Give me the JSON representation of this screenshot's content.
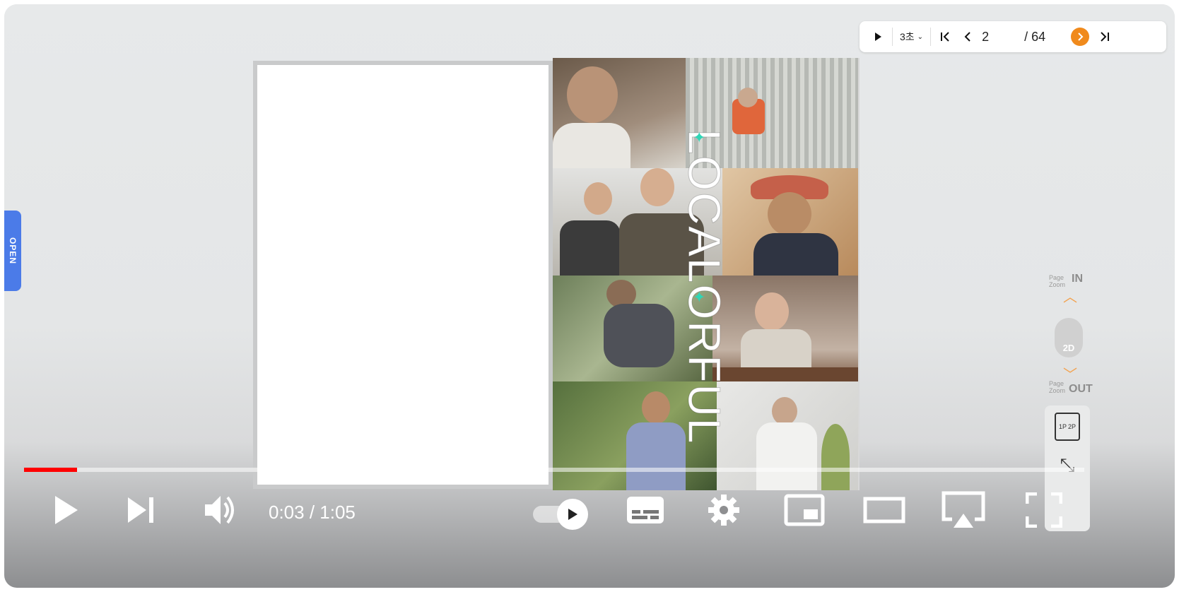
{
  "flipbook": {
    "interval": "3초",
    "current_page": "2",
    "total_pages": "/ 64"
  },
  "open_tab": {
    "label": "OPEN"
  },
  "cover": {
    "title": "LOCALORFUL"
  },
  "zoom": {
    "in_small": "Page Zoom",
    "in_big": "IN",
    "mode": "2D",
    "out_small": "Page Zoom",
    "out_big": "OUT"
  },
  "layout": {
    "one_page": "1P",
    "two_page": "2P"
  },
  "player": {
    "current_time": "0:03",
    "duration": "1:05",
    "time_display": "0:03 / 1:05",
    "progress": 0.05,
    "autoplay_on": true
  },
  "colors": {
    "progress": "#ff0000",
    "next_page_button": "#f08a1c",
    "open_tab": "#4b7be8",
    "sparkle": "#2fd6b6"
  },
  "icons": {
    "slideshow": "play-icon",
    "first_page": "first-page-icon",
    "prev_page": "chevron-left-icon",
    "next_page": "chevron-right-icon",
    "last_page": "last-page-icon",
    "video_play": "play-icon",
    "video_next": "skip-next-icon",
    "volume": "volume-icon",
    "subtitles": "subtitles-icon",
    "settings": "gear-icon",
    "miniplayer": "miniplayer-icon",
    "theater": "theater-mode-icon",
    "airplay": "airplay-icon",
    "fullscreen": "fullscreen-icon"
  }
}
